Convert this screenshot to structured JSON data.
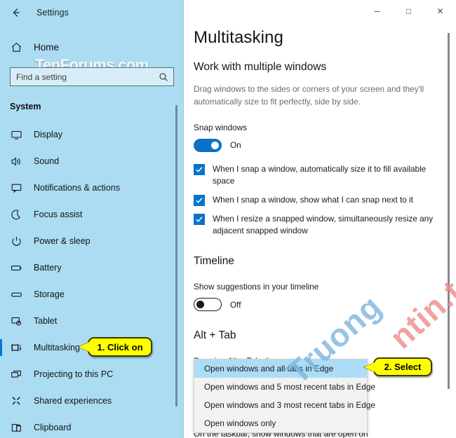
{
  "window": {
    "back_label": "back-arrow",
    "app_title": "Settings",
    "minimize": "─",
    "maximize": "□",
    "close": "✕"
  },
  "sidebar": {
    "home_label": "Home",
    "search": {
      "placeholder": "Find a setting",
      "value": ""
    },
    "watermark": "TenForums.com",
    "section_title": "System",
    "items": [
      {
        "label": "Display",
        "icon": "monitor-icon",
        "selected": false
      },
      {
        "label": "Sound",
        "icon": "speaker-icon",
        "selected": false
      },
      {
        "label": "Notifications & actions",
        "icon": "notification-icon",
        "selected": false
      },
      {
        "label": "Focus assist",
        "icon": "moon-icon",
        "selected": false
      },
      {
        "label": "Power & sleep",
        "icon": "power-icon",
        "selected": false
      },
      {
        "label": "Battery",
        "icon": "battery-icon",
        "selected": false
      },
      {
        "label": "Storage",
        "icon": "storage-icon",
        "selected": false
      },
      {
        "label": "Tablet",
        "icon": "tablet-icon",
        "selected": false
      },
      {
        "label": "Multitasking",
        "icon": "multitasking-icon",
        "selected": true
      },
      {
        "label": "Projecting to this PC",
        "icon": "project-icon",
        "selected": false
      },
      {
        "label": "Shared experiences",
        "icon": "share-icon",
        "selected": false
      },
      {
        "label": "Clipboard",
        "icon": "clipboard-icon",
        "selected": false
      }
    ]
  },
  "main": {
    "page_title": "Multitasking",
    "sections": {
      "work": {
        "heading": "Work with multiple windows",
        "description": "Drag windows to the sides or corners of your screen and they'll automatically size to fit perfectly, side by side.",
        "snap_label": "Snap windows",
        "snap_state": "On",
        "checkboxes": [
          "When I snap a window, automatically size it to fill available space",
          "When I snap a window, show what I can snap next to it",
          "When I resize a snapped window, simultaneously resize any adjacent snapped window"
        ]
      },
      "timeline": {
        "heading": "Timeline",
        "suggestions_label": "Show suggestions in your timeline",
        "suggestions_state": "Off"
      },
      "alttab": {
        "heading": "Alt + Tab",
        "field_label": "Pressing Alt + Tab shows",
        "options": [
          "Open windows and all tabs in Edge",
          "Open windows and 5 most recent tabs in Edge",
          "Open windows and 3 most recent tabs in Edge",
          "Open windows only"
        ],
        "selected_option": "Open windows and all tabs in Edge"
      },
      "taskbar_note": "On the taskbar, show windows that are open on"
    }
  },
  "callouts": [
    {
      "id": "callout-1",
      "text": "1. Click on"
    },
    {
      "id": "callout-2",
      "text": "2. Select"
    }
  ],
  "watermarks": {
    "left": "Truong",
    "right": "ntin.top"
  },
  "colors": {
    "sidebar_bg": "#abdcf2",
    "accent_blue": "#0078d4",
    "toggle_on": "#0a73c8",
    "callout_yellow": "#ffff00",
    "dropdown_selected": "#addcf6"
  }
}
